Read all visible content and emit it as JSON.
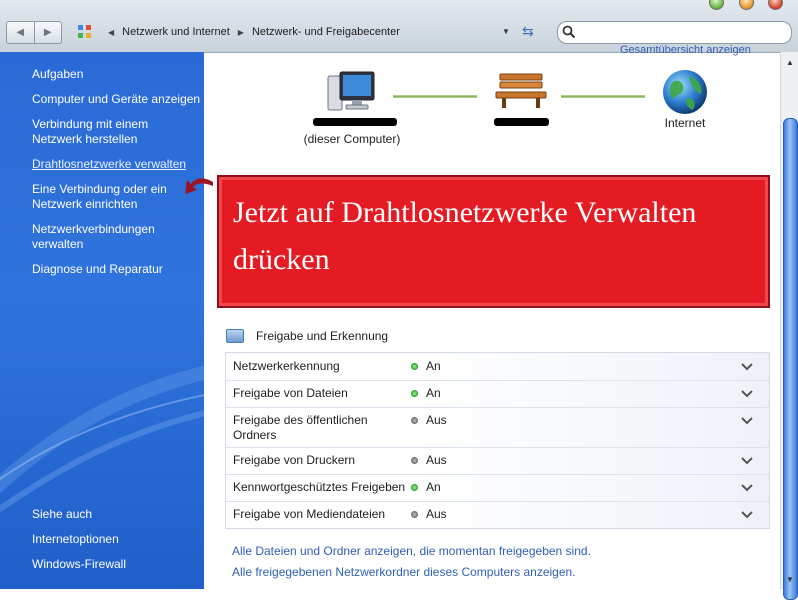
{
  "breadcrumb": {
    "items": [
      "Netzwerk und Internet",
      "Netzwerk- und Freigabecenter"
    ]
  },
  "sidebar": {
    "tasks_title": "Aufgaben",
    "tasks": [
      "Computer und Geräte anzeigen",
      "Verbindung mit einem Netzwerk herstellen",
      "Drahtlosnetzwerke verwalten",
      "Eine Verbindung oder ein Netzwerk einrichten",
      "Netzwerkverbindungen verwalten",
      "Diagnose und Reparatur"
    ],
    "see_also_title": "Siehe auch",
    "see_also": [
      "Internetoptionen",
      "Windows-Firewall"
    ]
  },
  "map": {
    "overview_link": "Gesamtübersicht anzeigen",
    "computer_sublabel": "(dieser Computer)",
    "internet_label": "Internet"
  },
  "callout": {
    "text": "Jetzt auf Drahtlosnetzwerke Verwalten drücken"
  },
  "sharing": {
    "title": "Freigabe und Erkennung",
    "rows": [
      {
        "label": "Netzwerkerkennung",
        "value": "An",
        "state": "on"
      },
      {
        "label": "Freigabe von Dateien",
        "value": "An",
        "state": "on"
      },
      {
        "label": "Freigabe des öffentlichen Ordners",
        "value": "Aus",
        "state": "off"
      },
      {
        "label": "Freigabe von Druckern",
        "value": "Aus",
        "state": "off"
      },
      {
        "label": "Kennwortgeschütztes Freigeben",
        "value": "An",
        "state": "on"
      },
      {
        "label": "Freigabe von Mediendateien",
        "value": "Aus",
        "state": "off"
      }
    ]
  },
  "links": [
    "Alle Dateien und Ordner anzeigen, die momentan freigegeben sind.",
    "Alle freigegebenen Netzwerkordner dieses Computers anzeigen."
  ],
  "colors": {
    "sidebar_blue": "#2a6ad6",
    "callout_red": "#e41b23",
    "link_blue": "#2f5fb3",
    "status_on": "#199f1a",
    "status_off": "#666666"
  }
}
